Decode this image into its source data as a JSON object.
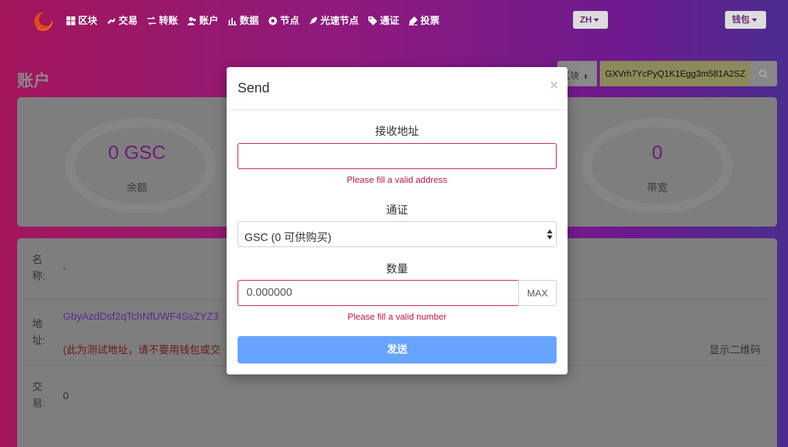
{
  "nav": {
    "items": [
      {
        "icon": "grid-icon",
        "label": "区块"
      },
      {
        "icon": "exchange-icon",
        "label": "交易"
      },
      {
        "icon": "transfer-icon",
        "label": "转账"
      },
      {
        "icon": "users-icon",
        "label": "账户"
      },
      {
        "icon": "bar-chart-icon",
        "label": "数据"
      },
      {
        "icon": "node-icon",
        "label": "节点"
      },
      {
        "icon": "rocket-icon",
        "label": "光速节点"
      },
      {
        "icon": "tag-icon",
        "label": "通证"
      },
      {
        "icon": "vote-icon",
        "label": "投票"
      }
    ],
    "lang_label": "ZH",
    "wallet_label": "钱包"
  },
  "search": {
    "type_label": "区块",
    "value": "GXVrh7YcPyQ1K1Egg3m581A2SZ"
  },
  "page": {
    "title": "账户",
    "stats": [
      {
        "value": "0 GSC",
        "label": "余额"
      },
      {
        "value": "0",
        "label": "带宽"
      }
    ],
    "info": {
      "name_key": "名称:",
      "name_value": "-",
      "address_key": "地址:",
      "address_value": "GbyAzdDsf2qTchNfUWF4SsZYZ3",
      "address_warning": "(此为测试地址，请不要用钱包或交",
      "qr_link": "显示二维码",
      "tx_key": "交易:",
      "tx_value": "0"
    }
  },
  "modal": {
    "title": "Send",
    "close_glyph": "×",
    "receive_label": "接收地址",
    "receive_value": "",
    "receive_error": "Please fill a valid address",
    "token_label": "通证",
    "token_selected": "GSC (0 可供购买)",
    "amount_label": "数量",
    "amount_placeholder": "0.000000",
    "max_label": "MAX",
    "amount_error": "Please fill a valid number",
    "send_label": "发送"
  },
  "colors": {
    "accent": "#c0134f",
    "send_button": "#66a4ff",
    "stat_value": "#6f1a75"
  }
}
